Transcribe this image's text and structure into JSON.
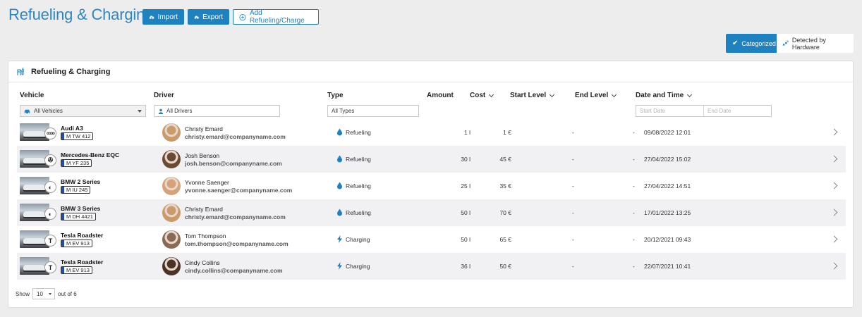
{
  "page": {
    "title": "Refueling & Charging"
  },
  "toolbar": {
    "import_label": "Import",
    "export_label": "Export",
    "add_label": "Add Refueling/Charge"
  },
  "view_toggle": {
    "categorized_label": "Categorized",
    "hardware_label": "Detected by Hardware",
    "active": "categorized"
  },
  "card": {
    "title": "Refueling & Charging"
  },
  "columns": {
    "vehicle": "Vehicle",
    "driver": "Driver",
    "type": "Type",
    "amount": "Amount",
    "cost": "Cost",
    "start_level": "Start Level",
    "end_level": "End Level",
    "date_time": "Date and Time"
  },
  "filters": {
    "vehicle": "All Vehicles",
    "driver": "All Drivers",
    "type": "All Types",
    "start_date_placeholder": "Start Date",
    "end_date_placeholder": "End Date"
  },
  "rows": [
    {
      "vehicle": "Audi A3",
      "plate": "M TW 412",
      "brand_icon": "audi-rings-icon",
      "driver": "Christy Emard",
      "email": "christy.emard@companyname.com",
      "type": "Refueling",
      "type_icon": "drop-icon",
      "amount": "1 l",
      "cost": "1 €",
      "start_level": "-",
      "end_level": "-",
      "date": "09/08/2022 12:01"
    },
    {
      "vehicle": "Mercedes-Benz EQC",
      "plate": "M YF 235",
      "brand_icon": "mercedes-star-icon",
      "driver": "Josh Benson",
      "email": "josh.benson@companyname.com",
      "type": "Refueling",
      "type_icon": "drop-icon",
      "amount": "30 l",
      "cost": "45 €",
      "start_level": "-",
      "end_level": "-",
      "date": "27/04/2022 15:02"
    },
    {
      "vehicle": "BMW 2 Series",
      "plate": "M IU 245",
      "brand_icon": "bmw-roundel-icon",
      "driver": "Yvonne Saenger",
      "email": "yvonne.saenger@companyname.com",
      "type": "Refueling",
      "type_icon": "drop-icon",
      "amount": "25 l",
      "cost": "35 €",
      "start_level": "-",
      "end_level": "-",
      "date": "27/04/2022 14:51"
    },
    {
      "vehicle": "BMW 3 Series",
      "plate": "M DH 4421",
      "brand_icon": "bmw-roundel-icon",
      "driver": "Christy Emard",
      "email": "christy.emard@companyname.com",
      "type": "Refueling",
      "type_icon": "drop-icon",
      "amount": "50 l",
      "cost": "70 €",
      "start_level": "-",
      "end_level": "-",
      "date": "17/01/2022 13:25"
    },
    {
      "vehicle": "Tesla Roadster",
      "plate": "M EV 913",
      "brand_icon": "tesla-t-icon",
      "driver": "Tom Thompson",
      "email": "tom.thompson@companyname.com",
      "type": "Charging",
      "type_icon": "bolt-icon",
      "amount": "50 l",
      "cost": "65 €",
      "start_level": "-",
      "end_level": "-",
      "date": "20/12/2021 09:43"
    },
    {
      "vehicle": "Tesla Roadster",
      "plate": "M EV 913",
      "brand_icon": "tesla-t-icon",
      "driver": "Cindy Collins",
      "email": "cindy.collins@companyname.com",
      "type": "Charging",
      "type_icon": "bolt-icon",
      "amount": "36 l",
      "cost": "50 €",
      "start_level": "-",
      "end_level": "-",
      "date": "22/07/2021 10:41"
    }
  ],
  "pagination": {
    "show_label": "Show",
    "page_size": "10",
    "total_label": "out of 6"
  },
  "colors": {
    "accent": "#1f82c0",
    "title": "#2d86c3",
    "stripe": "#f1f1f3"
  }
}
